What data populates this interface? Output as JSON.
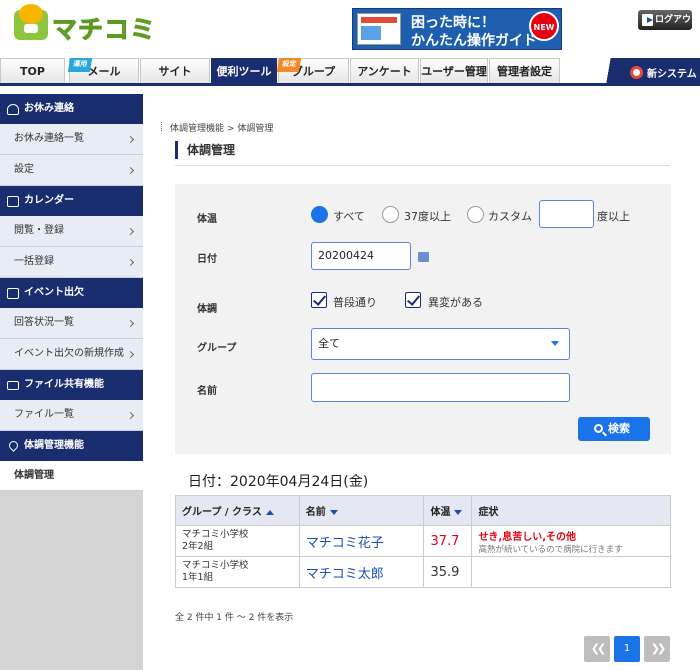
{
  "header": {
    "logo_text": "マチコミ",
    "banner": {
      "line1": "困った時に！",
      "line2": "かんたん操作ガイド",
      "badge": "NEW"
    },
    "logout_label": "ログアウト"
  },
  "nav": {
    "tabs": [
      {
        "label": "TOP"
      },
      {
        "label": "メール",
        "tag": "運用"
      },
      {
        "label": "サイト"
      },
      {
        "label": "便利ツール",
        "active": true
      },
      {
        "label": "グループ",
        "tag": "設定"
      },
      {
        "label": "アンケート"
      },
      {
        "label": "ユーザー管理"
      },
      {
        "label": "管理者設定"
      }
    ],
    "new_system_label": "新システム"
  },
  "sidebar": {
    "sections": [
      {
        "title": "お休み連絡",
        "icon": "person-icon",
        "items": [
          "お休み連絡一覧",
          "設定"
        ]
      },
      {
        "title": "カレンダー",
        "icon": "calendar-icon",
        "items": [
          "閲覧・登録",
          "一括登録"
        ]
      },
      {
        "title": "イベント出欠",
        "icon": "checkbox-icon",
        "items": [
          "回答状況一覧",
          "イベント出欠の新規作成"
        ]
      },
      {
        "title": "ファイル共有機能",
        "icon": "folder-icon",
        "items": [
          "ファイル一覧"
        ]
      },
      {
        "title": "体調管理機能",
        "icon": "heart-icon",
        "items": [
          "体調管理"
        ]
      }
    ]
  },
  "main": {
    "breadcrumb": {
      "parent": "体調管理機能",
      "sep": ">",
      "current": "体調管理"
    },
    "title": "体調管理",
    "form": {
      "temp_label": "体温",
      "temp_options": [
        "すべて",
        "37度以上",
        "カスタム"
      ],
      "temp_custom_value": "",
      "temp_suffix": "度以上",
      "date_label": "日付",
      "date_value": "20200424",
      "condition_label": "体調",
      "condition_options": [
        "普段通り",
        "異変がある"
      ],
      "group_label": "グループ",
      "group_value": "全て",
      "name_label": "名前",
      "name_value": "",
      "search_label": "検索"
    },
    "result_date": "日付：2020年04月24日(金)",
    "table": {
      "headers": [
        "グループ / クラス",
        "名前",
        "体温",
        "症状"
      ],
      "rows": [
        {
          "class_line1": "マチコミ小学校",
          "class_line2": "2年2組",
          "name": "マチコミ花子",
          "temp": "37.7",
          "symptom": "せき,息苦しい,その他",
          "note": "高熱が続いているので病院に行きます"
        },
        {
          "class_line1": "マチコミ小学校",
          "class_line2": "1年1組",
          "name": "マチコミ太郎",
          "temp": "35.9",
          "symptom": "",
          "note": ""
        }
      ]
    },
    "count_text": "全 2 件中 1 件 ～ 2 件を表示",
    "pagination": {
      "current": "1"
    }
  },
  "colors": {
    "navy": "#1a2d6e",
    "accent": "#1a73e8",
    "alert": "#e60012",
    "logo_green": "#8cc63f"
  }
}
